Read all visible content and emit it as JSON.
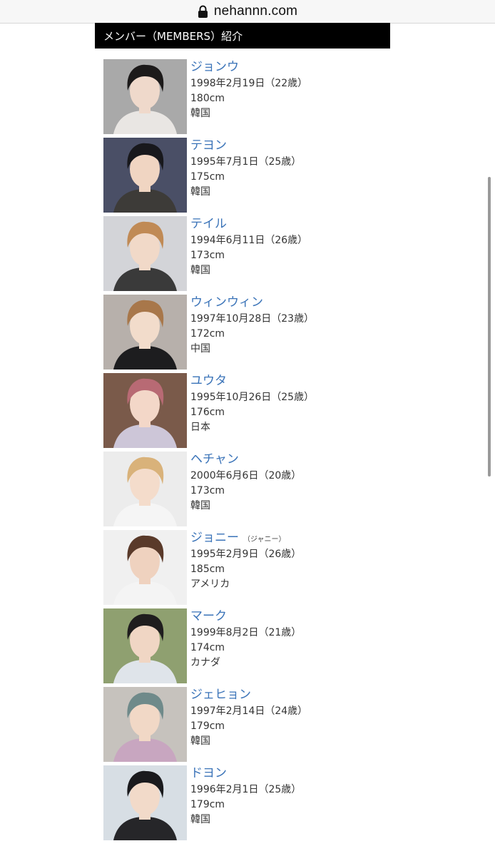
{
  "browser": {
    "url": "nehannn.com"
  },
  "section": {
    "title": "メンバー（MEMBERS）紹介"
  },
  "members": [
    {
      "name": "ジョンウ",
      "alias": "",
      "birth": "1998年2月19日（22歳）",
      "height": "180cm",
      "country": "韓国"
    },
    {
      "name": "テヨン",
      "alias": "",
      "birth": "1995年7月1日（25歳）",
      "height": "175cm",
      "country": "韓国"
    },
    {
      "name": "テイル",
      "alias": "",
      "birth": "1994年6月11日（26歳）",
      "height": "173cm",
      "country": "韓国"
    },
    {
      "name": "ウィンウィン",
      "alias": "",
      "birth": "1997年10月28日（23歳）",
      "height": "172cm",
      "country": "中国"
    },
    {
      "name": "ユウタ",
      "alias": "",
      "birth": "1995年10月26日（25歳）",
      "height": "176cm",
      "country": "日本"
    },
    {
      "name": "ヘチャン",
      "alias": "",
      "birth": "2000年6月6日（20歳）",
      "height": "173cm",
      "country": "韓国"
    },
    {
      "name": "ジョニー",
      "alias": "（ジャニー）",
      "birth": "1995年2月9日（26歳）",
      "height": "185cm",
      "country": "アメリカ"
    },
    {
      "name": "マーク",
      "alias": "",
      "birth": "1999年8月2日（21歳）",
      "height": "174cm",
      "country": "カナダ"
    },
    {
      "name": "ジェヒョン",
      "alias": "",
      "birth": "1997年2月14日（24歳）",
      "height": "179cm",
      "country": "韓国"
    },
    {
      "name": "ドヨン",
      "alias": "",
      "birth": "1996年2月1日（25歳）",
      "height": "179cm",
      "country": "韓国"
    }
  ],
  "photo_styles": [
    {
      "bg": "#a9a9a9",
      "hair": "#1c1a1a",
      "skin": "#efd9cb",
      "top": "#e9e6e3"
    },
    {
      "bg": "#4a4f66",
      "hair": "#18181c",
      "skin": "#f0d5c2",
      "top": "#3d3b38"
    },
    {
      "bg": "#d3d4d8",
      "hair": "#c08a55",
      "skin": "#f1d9c8",
      "top": "#3a3a3a"
    },
    {
      "bg": "#b7b0ab",
      "hair": "#a8774a",
      "skin": "#f2dccb",
      "top": "#1d1d1f"
    },
    {
      "bg": "#7a5a4a",
      "hair": "#b86a74",
      "skin": "#f3d7c8",
      "top": "#cdc6d8"
    },
    {
      "bg": "#ececec",
      "hair": "#d9b27a",
      "skin": "#f4dccb",
      "top": "#f5f5f5"
    },
    {
      "bg": "#f0f0f0",
      "hair": "#5a3a2a",
      "skin": "#efd2bf",
      "top": "#f4f4f4"
    },
    {
      "bg": "#8fa070",
      "hair": "#1f1d1e",
      "skin": "#f0d6c4",
      "top": "#dfe4ea"
    },
    {
      "bg": "#c6c2bd",
      "hair": "#6f8a8a",
      "skin": "#f1d8c6",
      "top": "#c8a6c0"
    },
    {
      "bg": "#d7dee4",
      "hair": "#1a1a1d",
      "skin": "#f2dac9",
      "top": "#262629"
    }
  ]
}
